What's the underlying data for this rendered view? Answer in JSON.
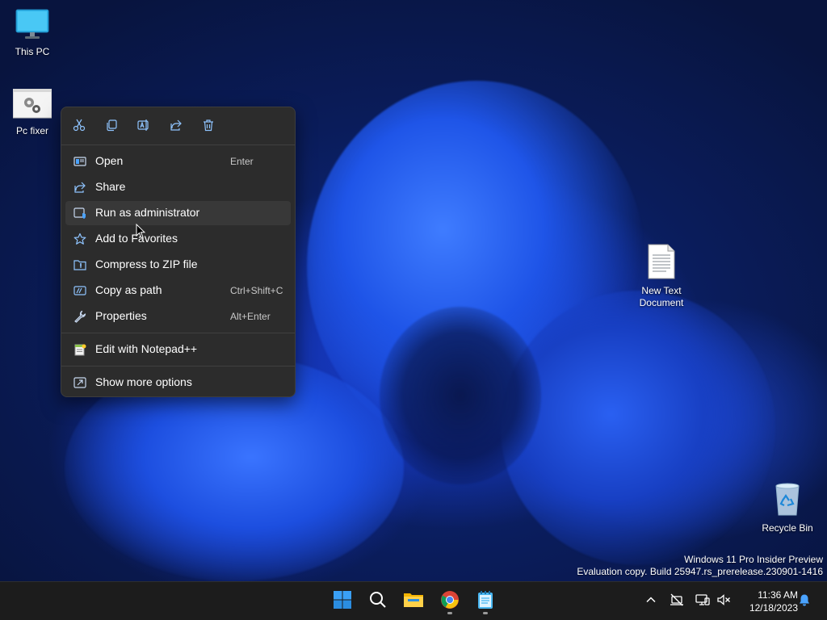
{
  "desktop": {
    "icons": [
      {
        "label": "This PC",
        "icon": "monitor-icon"
      },
      {
        "label": "Pc fixer",
        "icon": "gear-file-icon"
      },
      {
        "label": "New Text Document",
        "label_line1": "New Text",
        "label_line2": "Document",
        "icon": "text-file-icon"
      },
      {
        "label": "Recycle Bin",
        "icon": "recycle-bin-icon"
      }
    ]
  },
  "context_menu": {
    "quick_actions": [
      {
        "name": "Cut",
        "icon": "scissors-icon"
      },
      {
        "name": "Copy",
        "icon": "copy-icon"
      },
      {
        "name": "Rename",
        "icon": "rename-icon"
      },
      {
        "name": "Share",
        "icon": "share-icon"
      },
      {
        "name": "Delete",
        "icon": "trash-icon"
      }
    ],
    "items": [
      {
        "label": "Open",
        "shortcut": "Enter",
        "icon": "open-icon"
      },
      {
        "label": "Share",
        "shortcut": "",
        "icon": "share-icon"
      },
      {
        "label": "Run as administrator",
        "shortcut": "",
        "icon": "shield-window-icon"
      },
      {
        "label": "Add to Favorites",
        "shortcut": "",
        "icon": "star-icon"
      },
      {
        "label": "Compress to ZIP file",
        "shortcut": "",
        "icon": "zip-folder-icon"
      },
      {
        "label": "Copy as path",
        "shortcut": "Ctrl+Shift+C",
        "icon": "path-icon"
      },
      {
        "label": "Properties",
        "shortcut": "Alt+Enter",
        "icon": "wrench-icon"
      },
      {
        "label": "Edit with Notepad++",
        "shortcut": "",
        "icon": "notepad-plus-plus-icon"
      },
      {
        "label": "Show more options",
        "shortcut": "",
        "icon": "more-options-icon"
      }
    ],
    "hovered_item": "Run as administrator"
  },
  "watermark": {
    "line1": "Windows 11 Pro Insider Preview",
    "line2": "Evaluation copy. Build 25947.rs_prerelease.230901-1416"
  },
  "taskbar": {
    "apps": [
      {
        "name": "Start",
        "icon": "windows-logo-icon",
        "running": false
      },
      {
        "name": "Search",
        "icon": "search-icon",
        "running": false
      },
      {
        "name": "File Explorer",
        "icon": "folder-icon",
        "running": false
      },
      {
        "name": "Google Chrome",
        "icon": "chrome-icon",
        "running": true
      },
      {
        "name": "Notepad",
        "icon": "notepad-icon",
        "running": true
      }
    ],
    "tray": {
      "icons": [
        "chevron-up-icon",
        "network-offline-icon",
        "display-icon",
        "speaker-muted-icon",
        "notification-bell-icon"
      ]
    },
    "clock": {
      "time": "11:36 AM",
      "date": "12/18/2023"
    }
  },
  "colors": {
    "menu_background": "#2c2c2c",
    "menu_hover": "#383838",
    "taskbar_background": "#1c1c1c",
    "accent": "#0078d4"
  }
}
